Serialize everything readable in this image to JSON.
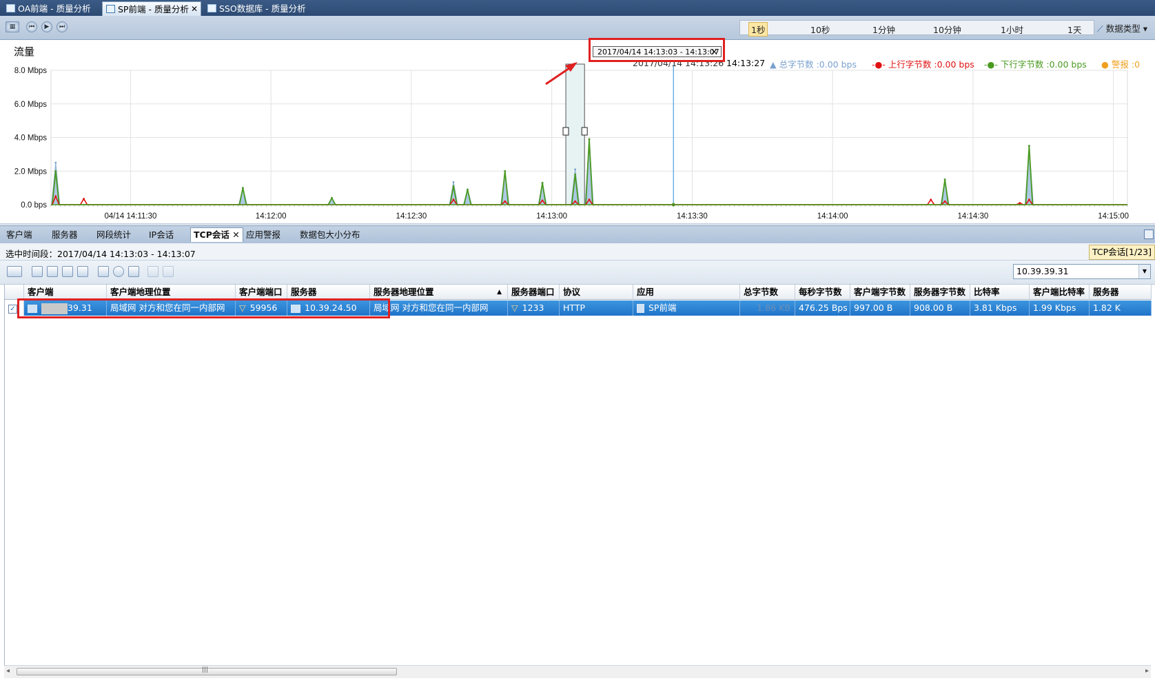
{
  "doc_tabs": [
    {
      "label": "OA前端 - 质量分析"
    },
    {
      "label": "SP前端 - 质量分析",
      "close": "✕"
    },
    {
      "label": "SSO数据库 - 质量分析"
    }
  ],
  "toolbar": {
    "time_scale": [
      "1秒",
      "10秒",
      "1分钟",
      "10分钟",
      "1小时",
      "1天"
    ],
    "time_scale_selected": "1秒",
    "data_type": "数据类型 ▾"
  },
  "chart": {
    "title": "流量",
    "selection_tooltip": "2017/04/14  14:13:03 - 14:13:07",
    "selection_close": "✕",
    "hover_time": "2017/04/14  14:13:26",
    "hover_time_end": "14:13:27",
    "legend": [
      {
        "label": "总字节数 :0.00 bps",
        "color": "#7aa1cf"
      },
      {
        "label": "上行字节数 :0.00 bps",
        "color": "#e01010"
      },
      {
        "label": "下行字节数 :0.00 bps",
        "color": "#4a9a20"
      },
      {
        "label": "警报 :0",
        "color": "#f0a020"
      }
    ]
  },
  "chart_data": {
    "type": "area",
    "title": "流量",
    "y_ticks": [
      "8.0 Mbps",
      "6.0 Mbps",
      "4.0 Mbps",
      "2.0 Mbps",
      "0.0 bps"
    ],
    "ylim": [
      0,
      8
    ],
    "y_unit": "Mbps",
    "x_ticks": [
      "04/14 14:11:30",
      "14:12:00",
      "14:12:30",
      "14:13:00",
      "14:13:30",
      "14:14:00",
      "14:14:30",
      "14:15:00"
    ],
    "selection": [
      "14:13:03",
      "14:13:07"
    ],
    "cursor": "14:13:26",
    "series": [
      {
        "name": "总字节数",
        "color": "#7aa1cf",
        "peaks": [
          [
            "14:11:14",
            2.5
          ],
          [
            "14:11:54",
            1.0
          ],
          [
            "14:12:13",
            0.4
          ],
          [
            "14:12:39",
            1.35
          ],
          [
            "14:12:42",
            0.9
          ],
          [
            "14:12:50",
            2.0
          ],
          [
            "14:12:58",
            1.3
          ],
          [
            "14:13:05",
            2.1
          ],
          [
            "14:13:08",
            3.9
          ],
          [
            "14:14:24",
            1.5
          ],
          [
            "14:14:42",
            3.5
          ]
        ]
      },
      {
        "name": "上行字节数",
        "color": "#e01010",
        "peaks": [
          [
            "14:11:14",
            0.5
          ],
          [
            "14:11:20",
            0.35
          ],
          [
            "14:12:39",
            0.3
          ],
          [
            "14:12:50",
            0.2
          ],
          [
            "14:12:58",
            0.25
          ],
          [
            "14:13:05",
            0.2
          ],
          [
            "14:13:08",
            0.3
          ],
          [
            "14:14:21",
            0.3
          ],
          [
            "14:14:24",
            0.2
          ],
          [
            "14:14:40",
            0.1
          ],
          [
            "14:14:42",
            0.3
          ]
        ]
      },
      {
        "name": "下行字节数",
        "color": "#4a9a20",
        "peaks": [
          [
            "14:11:14",
            2.0
          ],
          [
            "14:11:54",
            1.0
          ],
          [
            "14:12:13",
            0.4
          ],
          [
            "14:12:39",
            1.1
          ],
          [
            "14:12:42",
            0.9
          ],
          [
            "14:12:50",
            2.0
          ],
          [
            "14:12:58",
            1.3
          ],
          [
            "14:13:05",
            1.8
          ],
          [
            "14:13:08",
            3.9
          ],
          [
            "14:14:24",
            1.5
          ],
          [
            "14:14:42",
            3.5
          ]
        ]
      }
    ]
  },
  "view_tabs": [
    {
      "label": "客户端"
    },
    {
      "label": "服务器"
    },
    {
      "label": "网段统计"
    },
    {
      "label": "IP会话"
    },
    {
      "label": "TCP会话",
      "close": "✕"
    },
    {
      "label": "应用警报"
    },
    {
      "label": "数据包大小分布"
    }
  ],
  "range": {
    "label": "选中时间段：2017/04/14  14:13:03 - 14:13:07",
    "count": "TCP会话[1/23]"
  },
  "filter": {
    "value": "10.39.39.31"
  },
  "table": {
    "headers": [
      "客户端",
      "客户端地理位置",
      "客户端端口",
      "服务器",
      "服务器地理位置",
      "服务器端口",
      "协议",
      "应用",
      "总字节数",
      "每秒字节数",
      "客户端字节数",
      "服务器字节数",
      "比特率",
      "客户端比特率",
      "服务器"
    ],
    "sort_indicator": "▲",
    "rows": [
      [
        "39.31",
        "局域网 对方和您在同一内部网",
        "59956",
        "10.39.24.50",
        "局域网 对方和您在同一内部网",
        "1233",
        "HTTP",
        "SP前端",
        "1.86 KB",
        "476.25 Bps",
        "997.00 B",
        "908.00 B",
        "3.81 Kbps",
        "1.99 Kbps",
        "1.82 K"
      ]
    ],
    "row_checkbox": "✓"
  },
  "scrollbar": {
    "grip": "|||"
  }
}
